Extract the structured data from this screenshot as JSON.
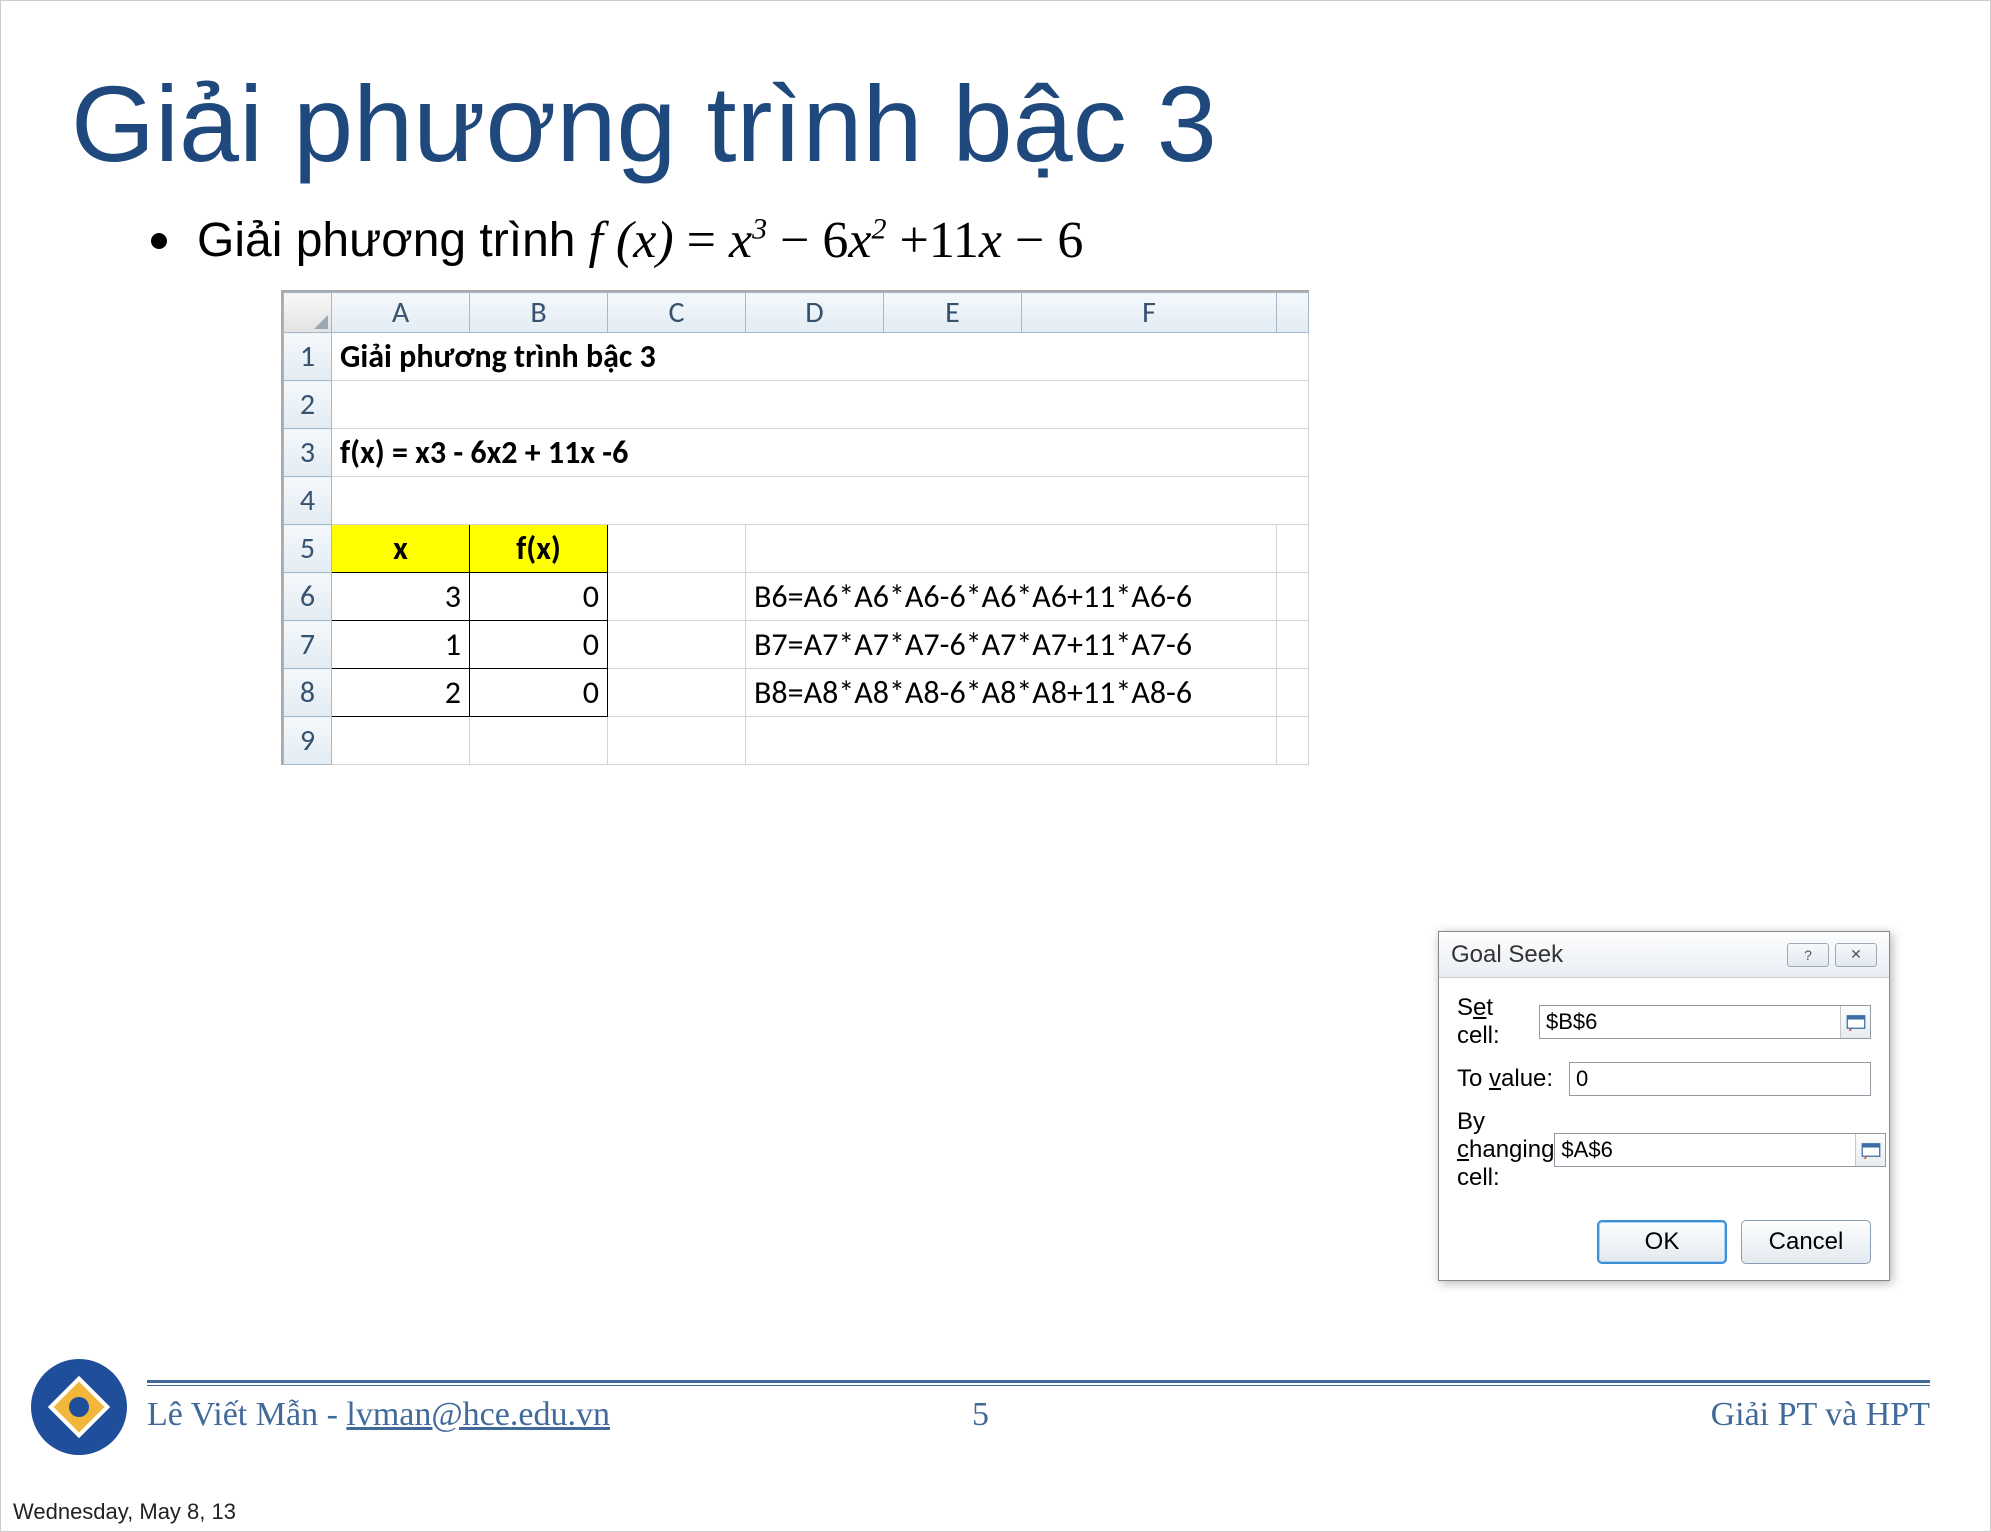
{
  "title": "Giải phương trình bậc 3",
  "bullet_prefix": "Giải phương trình ",
  "equation_html": "f (x) = x³ − 6x² + 11x − 6",
  "sheet": {
    "columns": [
      "A",
      "B",
      "C",
      "D",
      "E",
      "F"
    ],
    "rows": [
      "1",
      "2",
      "3",
      "4",
      "5",
      "6",
      "7",
      "8",
      "9"
    ],
    "r1_text": "Giải phương trình bậc 3",
    "r3_text": "f(x) = x3 - 6x2 + 11x -6",
    "header_x": "x",
    "header_fx": "f(x)",
    "data": [
      {
        "x": "3",
        "fx": "0",
        "formula": "B6=A6*A6*A6-6*A6*A6+11*A6-6"
      },
      {
        "x": "1",
        "fx": "0",
        "formula": "B7=A7*A7*A7-6*A7*A7+11*A7-6"
      },
      {
        "x": "2",
        "fx": "0",
        "formula": "B8=A8*A8*A8-6*A8*A8+11*A8-6"
      }
    ]
  },
  "dialog": {
    "title": "Goal Seek",
    "set_cell_label": "Set cell:",
    "set_cell_value": "$B$6",
    "to_value_label": "To value:",
    "to_value_value": "0",
    "by_changing_label": "By changing cell:",
    "by_changing_value": "$A$6",
    "ok": "OK",
    "cancel": "Cancel"
  },
  "footer": {
    "author": "Lê Viết Mẫn - ",
    "email": "lvman@hce.edu.vn",
    "page": "5",
    "topic": "Giải PT và HPT"
  },
  "date": "Wednesday, May 8, 13",
  "chart_data": {
    "type": "table",
    "title": "Giải phương trình bậc 3",
    "formula_text": "f(x) = x3 - 6x2 + 11x -6",
    "headers": [
      "x",
      "f(x)"
    ],
    "rows": [
      {
        "x": 3,
        "fx": 0,
        "cell_formula": "B6=A6*A6*A6-6*A6*A6+11*A6-6"
      },
      {
        "x": 1,
        "fx": 0,
        "cell_formula": "B7=A7*A7*A7-6*A7*A7+11*A7-6"
      },
      {
        "x": 2,
        "fx": 0,
        "cell_formula": "B8=A8*A8*A8-6*A8*A8+11*A8-6"
      }
    ]
  }
}
